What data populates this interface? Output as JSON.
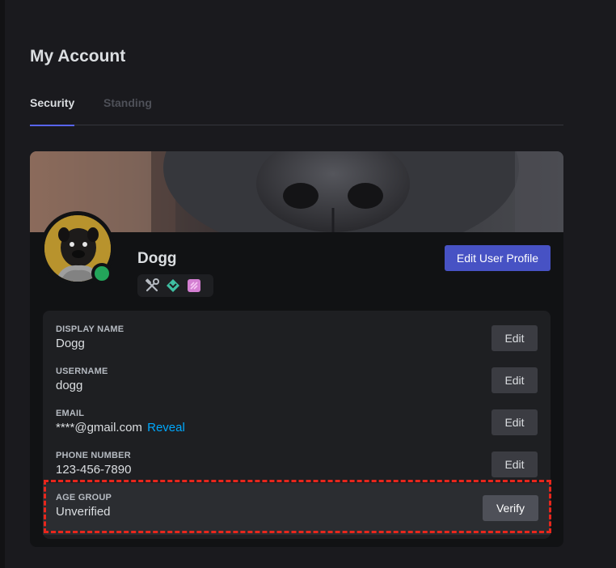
{
  "page": {
    "title": "My Account"
  },
  "tabs": [
    {
      "label": "Security",
      "active": true
    },
    {
      "label": "Standing",
      "active": false
    }
  ],
  "profile": {
    "display_username": "Dogg",
    "status_color": "#23a55a",
    "edit_profile_label": "Edit User Profile",
    "badges": [
      "hammer-wrench-icon",
      "hypesquad-icon",
      "nitro-icon"
    ]
  },
  "fields": [
    {
      "label": "DISPLAY NAME",
      "value": "Dogg",
      "action": "Edit"
    },
    {
      "label": "USERNAME",
      "value": "dogg",
      "action": "Edit"
    },
    {
      "label": "EMAIL",
      "value": "****@gmail.com",
      "extra": "Reveal",
      "action": "Edit"
    },
    {
      "label": "PHONE NUMBER",
      "value": "123-456-7890",
      "action": "Edit"
    }
  ],
  "age_group": {
    "label": "AGE GROUP",
    "value": "Unverified",
    "action": "Verify"
  },
  "colors": {
    "accent": "#5865f2",
    "link": "#00a8fc",
    "highlight": "#e8261c"
  }
}
